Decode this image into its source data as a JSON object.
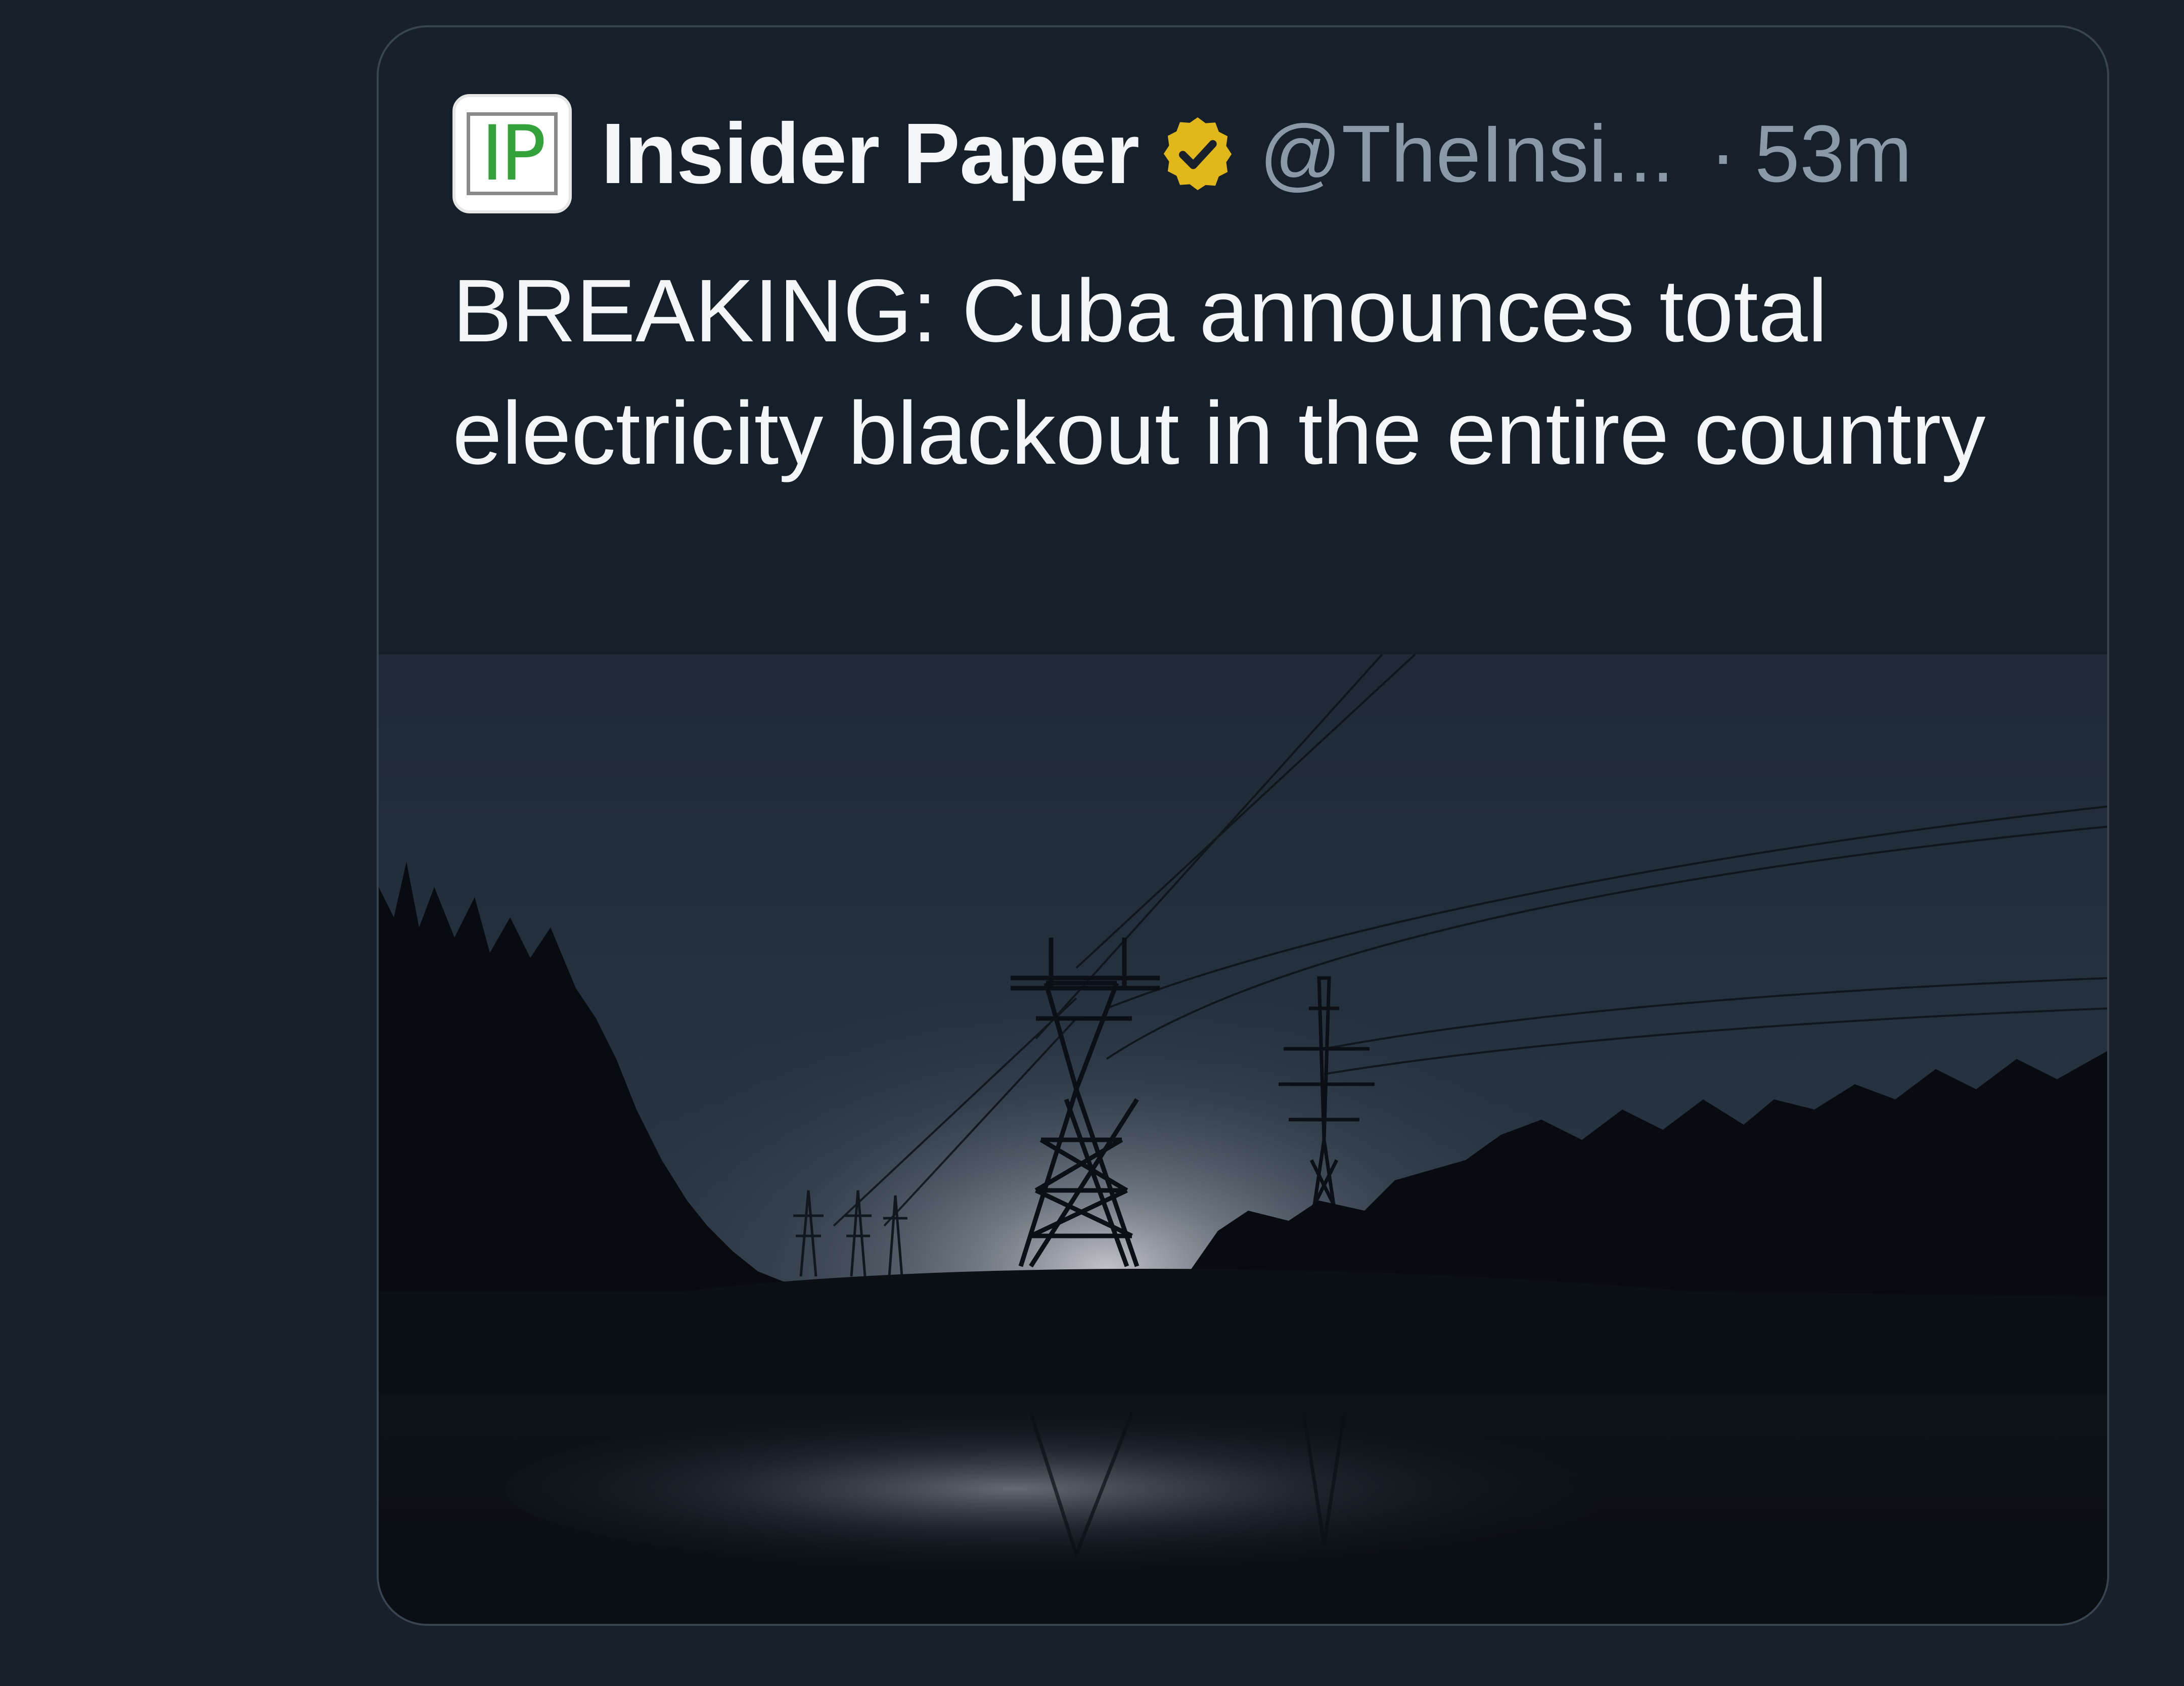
{
  "tweet": {
    "author_initials": "IP",
    "author_name": "Insider Paper",
    "handle": "@TheInsi...",
    "separator": "·",
    "time": "53m",
    "text": "BREAKING: Cuba announces total electricity blackout in the entire country",
    "verified_icon": "verified-gold-badge",
    "colors": {
      "background": "#17202b",
      "card_border": "#38444f",
      "text": "#f4f5f6",
      "muted": "#8b98a5",
      "badge": "#e2b719",
      "logo_green": "#34a23a"
    }
  }
}
